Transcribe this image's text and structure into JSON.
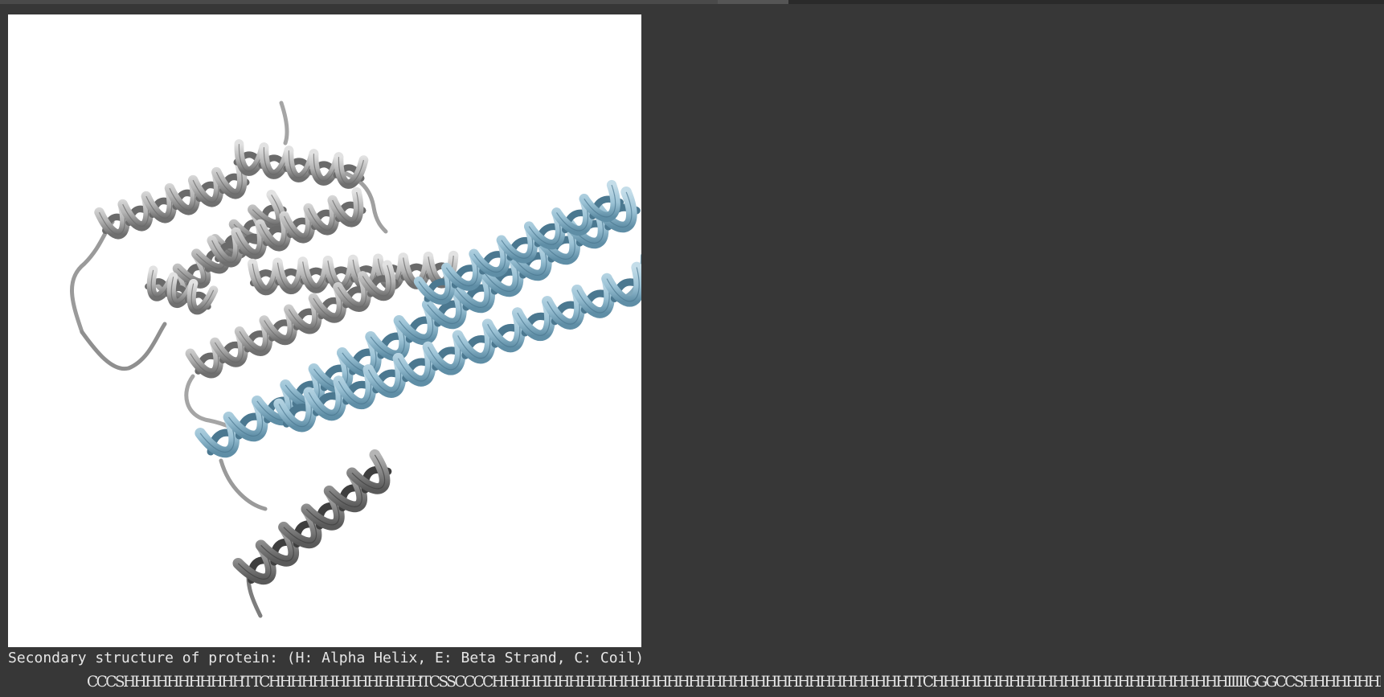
{
  "colors": {
    "background": "#373737",
    "viewer_background": "#ffffff",
    "helix_gray": "#b9b9b9",
    "helix_gray_dark": "#8a8a8a",
    "helix_blue": "#9cc3d6",
    "text": "#e6e6e6"
  },
  "caption": "Secondary structure of protein: (H: Alpha Helix, E: Beta Strand, C: Coil)",
  "sequence": "CCCSHHHHHHHHHHHTTCHHHHHHHHHHHHHHTCSSCCCCHHHHHHHHHHHHHHHHHHHHHHHHHHHHHHHHHHHHHHTTCHHHHHHHHHHHHHHHHHHHHHHHHHHHIIIIIGGGCCSHHHHHHHHHHHHHHHHHHHHHCCHHHHHHHH"
}
